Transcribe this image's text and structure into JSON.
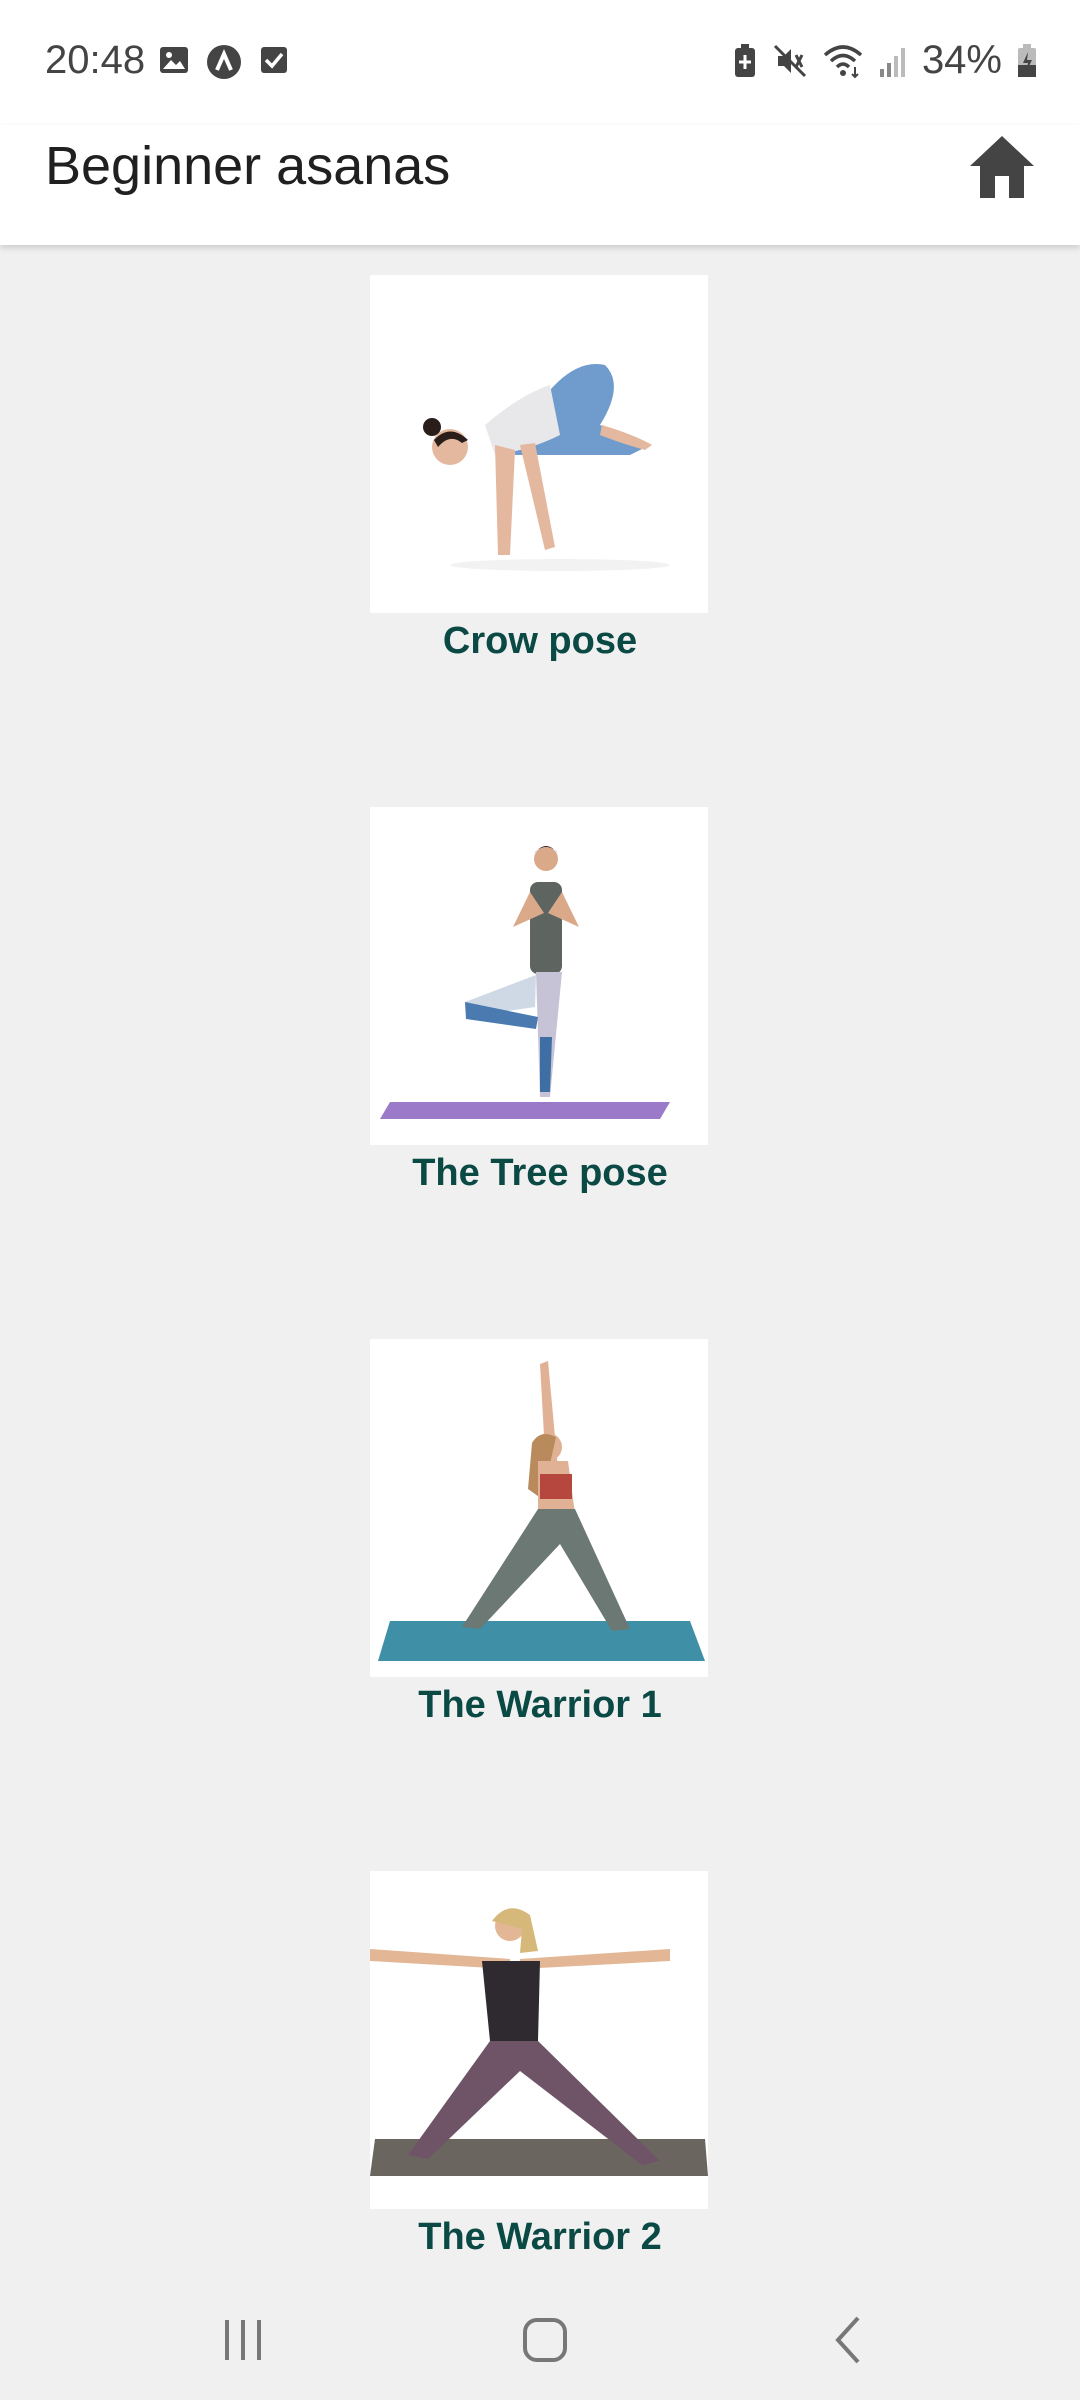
{
  "status_bar": {
    "time": "20:48",
    "battery_percent": "34%",
    "left_icons": [
      "gallery-icon",
      "app-icon",
      "checkbox-icon"
    ],
    "right_icons": [
      "battery-saver-icon",
      "mute-icon",
      "wifi-icon",
      "signal-icon",
      "battery-icon"
    ]
  },
  "app_bar": {
    "title": "Beginner asanas",
    "home_icon": "home-icon"
  },
  "asanas": [
    {
      "label": "Crow pose"
    },
    {
      "label": "The Tree pose"
    },
    {
      "label": "The Warrior 1"
    },
    {
      "label": "The Warrior 2"
    }
  ],
  "nav_bar": {
    "items": [
      "recents-icon",
      "home-circle-icon",
      "back-icon"
    ]
  },
  "colors": {
    "label": "#0b4a44",
    "background": "#f0f0f1",
    "mat_purple": "#9b7bc9",
    "mat_teal": "#3f8fa6",
    "mat_gray": "#6a665f"
  }
}
